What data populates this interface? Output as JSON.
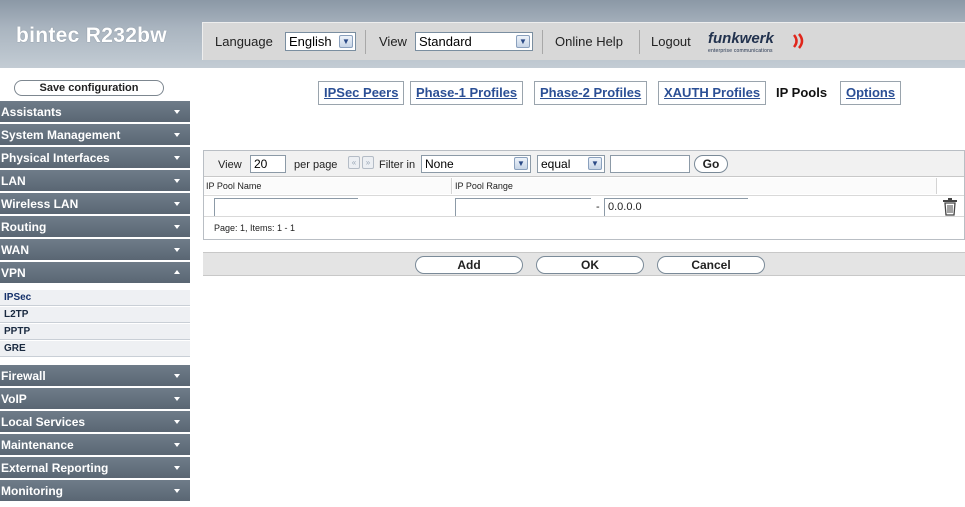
{
  "header": {
    "brand": "bintec R232bw",
    "language_label": "Language",
    "language_value": "English",
    "view_label": "View",
    "view_value": "Standard",
    "online_help": "Online Help",
    "logout": "Logout",
    "logo_text": "funkwerk",
    "logo_subtext": "enterprise communications"
  },
  "sidebar": {
    "save_label": "Save configuration",
    "items": [
      {
        "label": "Assistants",
        "expanded": false
      },
      {
        "label": "System Management",
        "expanded": false
      },
      {
        "label": "Physical Interfaces",
        "expanded": false
      },
      {
        "label": "LAN",
        "expanded": false
      },
      {
        "label": "Wireless LAN",
        "expanded": false
      },
      {
        "label": "Routing",
        "expanded": false
      },
      {
        "label": "WAN",
        "expanded": false
      },
      {
        "label": "VPN",
        "expanded": true
      },
      {
        "label": "Firewall",
        "expanded": false
      },
      {
        "label": "VoIP",
        "expanded": false
      },
      {
        "label": "Local Services",
        "expanded": false
      },
      {
        "label": "Maintenance",
        "expanded": false
      },
      {
        "label": "External Reporting",
        "expanded": false
      },
      {
        "label": "Monitoring",
        "expanded": false
      }
    ],
    "vpn_subitems": [
      "IPSec",
      "L2TP",
      "PPTP",
      "GRE"
    ],
    "active_subitem": "IPSec"
  },
  "tabs": [
    {
      "label": "IPSec Peers",
      "active": false
    },
    {
      "label": "Phase-1 Profiles",
      "active": false
    },
    {
      "label": "Phase-2 Profiles",
      "active": false
    },
    {
      "label": "XAUTH Profiles",
      "active": false
    },
    {
      "label": "IP Pools",
      "active": true
    },
    {
      "label": "Options",
      "active": false
    }
  ],
  "filter": {
    "view_label": "View",
    "view_value": "20",
    "per_page_label": "per page",
    "prev_glyph": "«",
    "next_glyph": "»",
    "filter_in_label": "Filter in",
    "filter_field": "None",
    "operator": "equal",
    "value": "",
    "go_label": "Go"
  },
  "table": {
    "columns": [
      "IP Pool Name",
      "IP Pool Range"
    ],
    "row": {
      "name": "",
      "range_start": "",
      "range_sep": "-",
      "range_end": "0.0.0.0"
    },
    "page_info": "Page: 1, Items: 1 - 1"
  },
  "actions": {
    "add": "Add",
    "ok": "OK",
    "cancel": "Cancel"
  },
  "colors": {
    "nav_bg": "#5f6b78",
    "link": "#2b4f95",
    "header_bg": "#a3aeb9"
  }
}
